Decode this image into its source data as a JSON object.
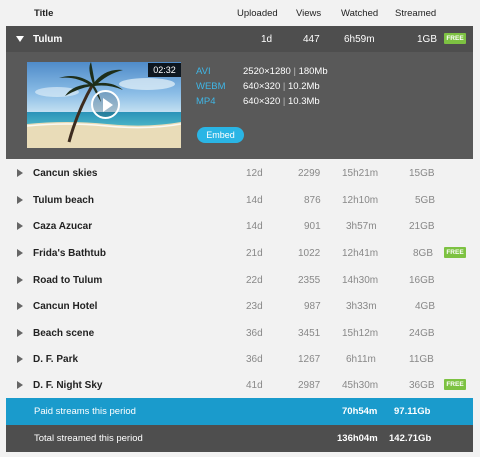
{
  "columns": {
    "title": "Title",
    "uploaded": "Uploaded",
    "views": "Views",
    "watched": "Watched",
    "streamed": "Streamed"
  },
  "expanded": {
    "title": "Tulum",
    "uploaded": "1d",
    "views": "447",
    "watched": "6h59m",
    "streamed": "1GB",
    "badge": "FREE",
    "duration": "02:32",
    "formats": [
      {
        "name": "AVI",
        "resolution": "2520×1280",
        "size": "180Mb"
      },
      {
        "name": "WEBM",
        "resolution": "640×320",
        "size": "10.2Mb"
      },
      {
        "name": "MP4",
        "resolution": "640×320",
        "size": "10.3Mb"
      }
    ],
    "embed_label": "Embed"
  },
  "rows": [
    {
      "title": "Cancun skies",
      "uploaded": "12d",
      "views": "2299",
      "watched": "15h21m",
      "streamed": "15GB",
      "badge": ""
    },
    {
      "title": "Tulum beach",
      "uploaded": "14d",
      "views": "876",
      "watched": "12h10m",
      "streamed": "5GB",
      "badge": ""
    },
    {
      "title": "Caza Azucar",
      "uploaded": "14d",
      "views": "901",
      "watched": "3h57m",
      "streamed": "21GB",
      "badge": ""
    },
    {
      "title": "Frida's Bathtub",
      "uploaded": "21d",
      "views": "1022",
      "watched": "12h41m",
      "streamed": "8GB",
      "badge": "FREE"
    },
    {
      "title": "Road to Tulum",
      "uploaded": "22d",
      "views": "2355",
      "watched": "14h30m",
      "streamed": "16GB",
      "badge": ""
    },
    {
      "title": "Cancun Hotel",
      "uploaded": "23d",
      "views": "987",
      "watched": "3h33m",
      "streamed": "4GB",
      "badge": ""
    },
    {
      "title": "Beach scene",
      "uploaded": "36d",
      "views": "3451",
      "watched": "15h12m",
      "streamed": "24GB",
      "badge": ""
    },
    {
      "title": "D. F. Park",
      "uploaded": "36d",
      "views": "1267",
      "watched": "6h11m",
      "streamed": "11GB",
      "badge": ""
    },
    {
      "title": "D. F. Night Sky",
      "uploaded": "41d",
      "views": "2987",
      "watched": "45h30m",
      "streamed": "36GB",
      "badge": "FREE"
    }
  ],
  "summary": {
    "paid_label": "Paid streams this period",
    "paid_watched": "70h54m",
    "paid_streamed": "97.11Gb",
    "total_label": "Total streamed this period",
    "total_watched": "136h04m",
    "total_streamed": "142.71Gb"
  }
}
